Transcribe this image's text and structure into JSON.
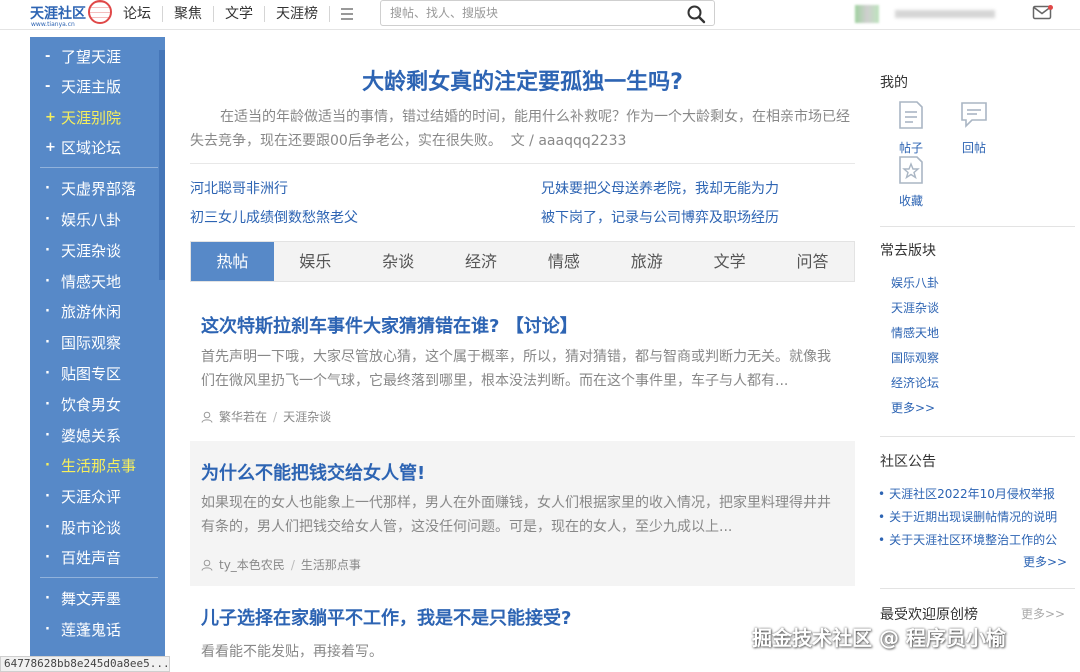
{
  "topbar": {
    "logo_text": "天涯社区",
    "logo_sub": "www.tianya.cn",
    "nav": [
      "论坛",
      "聚焦",
      "文学",
      "天涯榜"
    ],
    "search_placeholder": "搜帖、找人、搜版块"
  },
  "sidebar": {
    "group1": [
      {
        "mark": "-",
        "label": "了望天涯",
        "highlight": false
      },
      {
        "mark": "-",
        "label": "天涯主版",
        "highlight": false
      },
      {
        "mark": "+",
        "label": "天涯别院",
        "highlight": true
      },
      {
        "mark": "+",
        "label": "区域论坛",
        "highlight": false
      }
    ],
    "group2": [
      {
        "label": "天虚界部落",
        "highlight": false
      },
      {
        "label": "娱乐八卦",
        "highlight": false
      },
      {
        "label": "天涯杂谈",
        "highlight": false
      },
      {
        "label": "情感天地",
        "highlight": false
      },
      {
        "label": "旅游休闲",
        "highlight": false
      },
      {
        "label": "国际观察",
        "highlight": false
      },
      {
        "label": "贴图专区",
        "highlight": false
      },
      {
        "label": "饮食男女",
        "highlight": false
      },
      {
        "label": "婆媳关系",
        "highlight": false
      },
      {
        "label": "生活那点事",
        "highlight": true
      },
      {
        "label": "天涯众评",
        "highlight": false
      },
      {
        "label": "股市论谈",
        "highlight": false
      },
      {
        "label": "百姓声音",
        "highlight": false
      }
    ],
    "group3": [
      {
        "label": "舞文弄墨",
        "highlight": false
      },
      {
        "label": "莲蓬鬼话",
        "highlight": false
      }
    ],
    "status_url": "64778628bb8e245d0a8ee5..."
  },
  "main": {
    "headline": "大龄剩女真的注定要孤独一生吗?",
    "summary": "在适当的年龄做适当的事情，错过结婚的时间，能用什么补救呢？作为一个大龄剩女，在相亲市场已经失去竞争，现在还要跟00后争老公，实在很失败。",
    "summary_author": "文 / aaaqqq2233",
    "links": [
      "河北聪哥非洲行",
      "兄妹要把父母送养老院，我却无能为力",
      "初三女儿成绩倒数愁煞老父",
      "被下岗了，记录与公司博弈及职场经历"
    ],
    "tabs": [
      "热帖",
      "娱乐",
      "杂谈",
      "经济",
      "情感",
      "旅游",
      "文学",
      "问答"
    ],
    "posts": [
      {
        "title": "这次特斯拉刹车事件大家猜猜错在谁? 【讨论】",
        "body": "首先声明一下哦，大家尽管放心猜，这个属于概率，所以，猜对猜错，都与智商或判断力无关。就像我们在微风里扔飞一个气球，它最终落到哪里，根本没法判断。而在这个事件里，车子与人都有...",
        "author": "繁华若在",
        "board": "天涯杂谈"
      },
      {
        "title": "为什么不能把钱交给女人管!",
        "body": "如果现在的女人也能象上一代那样，男人在外面赚钱，女人们根据家里的收入情况，把家里料理得井井有条的，男人们把钱交给女人管，这没任何问题。可是，现在的女人，至少九成以上...",
        "author": "ty_本色农民",
        "board": "生活那点事"
      },
      {
        "title": "儿子选择在家躺平不工作，我是不是只能接受?",
        "body": "看看能不能发贴，再接着写。"
      }
    ]
  },
  "right": {
    "my_title": "我的",
    "my_items": [
      "帖子",
      "回帖",
      "收藏"
    ],
    "frequent_title": "常去版块",
    "frequent": [
      "娱乐八卦",
      "天涯杂谈",
      "情感天地",
      "国际观察",
      "经济论坛"
    ],
    "frequent_more": "更多>>",
    "announce_title": "社区公告",
    "announcements": [
      "天涯社区2022年10月侵权举报",
      "关于近期出现误删帖情况的说明",
      "关于天涯社区环境整治工作的公"
    ],
    "announce_more": "更多>>",
    "popular_title": "最受欢迎原创榜",
    "popular_more": "更多>>"
  },
  "watermark": "掘金技术社区 @ 程序员小榆",
  "colors": {
    "brand_blue": "#2d64b3",
    "sidebar_bg": "#5789c8",
    "highlight_yellow": "#f7ef5c"
  }
}
